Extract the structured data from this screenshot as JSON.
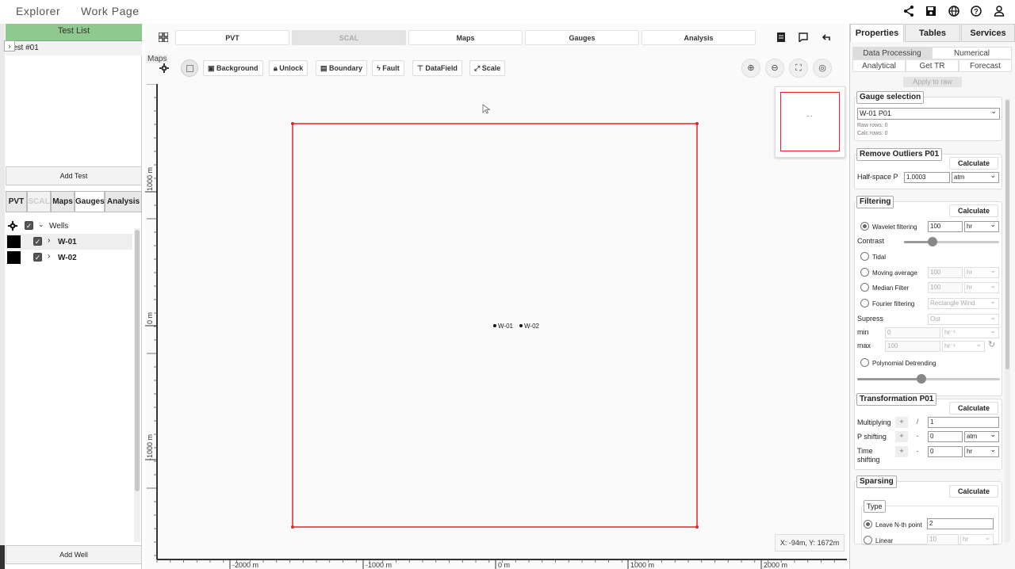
{
  "topbar": {
    "explorer": "Explorer",
    "workpage": "Work Page"
  },
  "left": {
    "test_list_title": "Test List",
    "test_item": "Test #01",
    "add_test": "Add Test",
    "tabs": [
      "PVT",
      "SCAL",
      "Maps",
      "Gauges",
      "Analysis"
    ],
    "wells_label": "Wells",
    "wells": [
      "W-01",
      "W-02"
    ],
    "add_well": "Add Well"
  },
  "main": {
    "tabs": [
      "PVT",
      "SCAL",
      "Maps",
      "Gauges",
      "Analysis"
    ],
    "maps_label": "Maps",
    "toolbar": {
      "background": "Background",
      "unlock": "Unlock",
      "boundary": "Boundary",
      "fault": "Fault",
      "datafield": "DataField",
      "scale": "Scale"
    },
    "coords": "X: -94m, Y: 1672m",
    "y_ticks": [
      "1000 m",
      "0 m",
      "-1000 m"
    ],
    "x_ticks": [
      "-2000 m",
      "-1000 m",
      "0 m",
      "1000 m",
      "2000 m"
    ],
    "wells": [
      "W-01",
      "W-02"
    ],
    "minimap_text": ". ."
  },
  "right": {
    "tabs": [
      "Properties",
      "Tables",
      "Services"
    ],
    "subtabs": [
      "Data Processing",
      "Numerical",
      "Analytical",
      "Get TR",
      "Forecast"
    ],
    "apply_raw": "Apply to raw",
    "gauge_title": "Gauge selection",
    "gauge_value": "W-01 P01",
    "raw_rows": "Raw rows: 0",
    "calc_rows": "Calc rows: 0",
    "outliers_title": "Remove Outliers P01",
    "calculate": "Calculate",
    "half_space": "Half-space P",
    "half_space_val": "1.0003",
    "unit_atm": "atm",
    "unit_hr": "hr",
    "unit_hr_inv": "hr⁻¹",
    "filtering_title": "Filtering",
    "wavelet": "Wavelet filtering",
    "wavelet_val": "100",
    "contrast": "Contrast",
    "contrast_level": 0.3,
    "detrend_level": 0.45,
    "tidal": "Tidal",
    "moving_avg": "Moving average",
    "moving_val": "100",
    "median": "Median Filter",
    "median_val": "100",
    "fourier": "Fourier filtering",
    "fourier_type": "Rectangle Wind",
    "supress": "Supress",
    "supress_val": "Out",
    "min": "min",
    "min_val": "0",
    "max": "max",
    "max_val": "100",
    "poly": "Polynomial Detrending",
    "transform_title": "Transformation P01",
    "multiplying": "Multiplying",
    "mult_val": "1",
    "p_shift": "P shifting",
    "p_val": "0",
    "time_shift": "Time shifting",
    "t_val": "0",
    "sparsing_title": "Sparsing",
    "type_label": "Type",
    "leave_nth": "Leave N-th point",
    "nth_val": "2",
    "linear": "Linear",
    "linear_val": "10"
  }
}
